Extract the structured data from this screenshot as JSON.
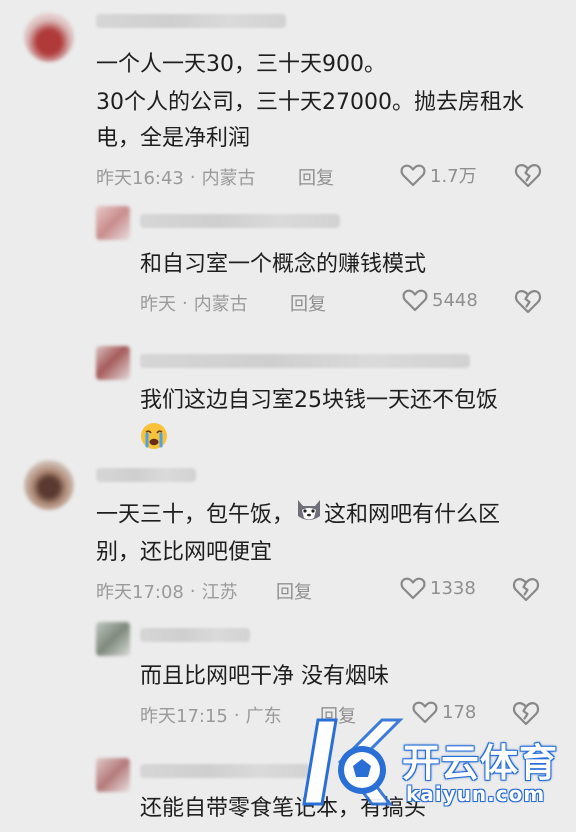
{
  "comments": [
    {
      "lines": [
        "一个人一天30，三十天900。",
        "30个人的公司，三十天27000。抛去房租水",
        "电，全是净利润"
      ],
      "time": "昨天16:43",
      "sep": "·",
      "location": "内蒙古",
      "reply": "回复",
      "likes": "1.7万"
    },
    {
      "lines": [
        "和自习室一个概念的赚钱模式"
      ],
      "time": "昨天",
      "sep": "·",
      "location": "内蒙古",
      "reply": "回复",
      "likes": "5448"
    },
    {
      "lines": [
        "我们这边自习室25块钱一天还不包饭"
      ],
      "emoji": "crying-face"
    },
    {
      "line1_a": "一天三十，包午饭，",
      "line1_b": "这和网吧有什么区",
      "line2": "别，还比网吧便宜",
      "time": "昨天17:08",
      "sep": "·",
      "location": "江苏",
      "reply": "回复",
      "likes": "1338"
    },
    {
      "lines": [
        "而且比网吧干净 没有烟味"
      ],
      "time": "昨天17:15",
      "sep": "·",
      "location": "广东",
      "reply": "回复",
      "likes": "178"
    },
    {
      "lines": [
        "还能自带零食笔记本，有搞头"
      ]
    }
  ],
  "watermark": {
    "cn": "开云体育",
    "en": "kaiyun.com"
  },
  "colors": {
    "background": "#ececec",
    "text": "#1e1e1e",
    "meta": "#9a9a9a",
    "watermark_blue": "#2a6fd6"
  }
}
